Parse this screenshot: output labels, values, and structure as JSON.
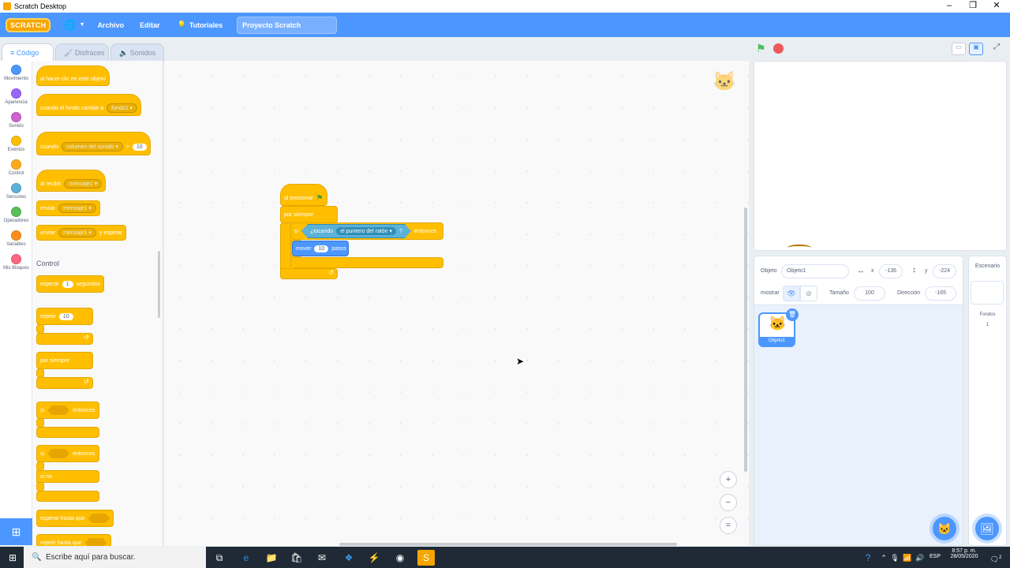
{
  "window": {
    "title": "Scratch Desktop"
  },
  "menu": {
    "logo": "SCRATCH",
    "archivo": "Archivo",
    "editar": "Editar",
    "tutoriales": "Tutoriales",
    "project_name": "Proyecto Scratch"
  },
  "tabs": {
    "code": "Código",
    "costumes": "Disfraces",
    "sounds": "Sonidos"
  },
  "categories": [
    {
      "label": "Movimiento",
      "color": "#4c97ff"
    },
    {
      "label": "Apariencia",
      "color": "#9966ff"
    },
    {
      "label": "Sonido",
      "color": "#cf63cf"
    },
    {
      "label": "Eventos",
      "color": "#ffbf00"
    },
    {
      "label": "Control",
      "color": "#ffab19"
    },
    {
      "label": "Sensores",
      "color": "#5cb1d6"
    },
    {
      "label": "Operadores",
      "color": "#59c059"
    },
    {
      "label": "Variables",
      "color": "#ff8c1a"
    },
    {
      "label": "Mis Bloques",
      "color": "#ff6680"
    }
  ],
  "palette": {
    "ev_click": "al hacer clic en este objeto",
    "ev_backdrop": "cuando el fondo cambie a",
    "ev_backdrop_val": "fondo1",
    "ev_when": "cuando",
    "ev_when_dd": "volumen del sonido",
    "ev_gt": ">",
    "ev_when_val": "10",
    "ev_receive": "al recibir",
    "ev_msg": "mensaje1",
    "ev_send": "enviar",
    "ev_send_msg": "mensaje1",
    "ev_send_wait": "enviar",
    "ev_send_wait_msg": "mensaje1",
    "ev_send_wait_tail": "y esperar",
    "control_heading": "Control",
    "c_wait": "esperar",
    "c_wait_val": "1",
    "c_wait_tail": "segundos",
    "c_repeat": "repetir",
    "c_repeat_val": "10",
    "c_forever": "por siempre",
    "c_if": "si",
    "c_if_tail": "entonces",
    "c_ifelse": "si",
    "c_ifelse_tail": "entonces",
    "c_else": "si no",
    "c_waituntil": "esperar hasta que",
    "c_repeatuntil": "repetir hasta que"
  },
  "script": {
    "hat": "al presionar",
    "forever": "por siempre",
    "if": "si",
    "touching": "¿tocando",
    "touching_dd": "el puntero del ratón",
    "question": "?",
    "then": "entonces",
    "move": "mover",
    "move_val": "10",
    "steps": "pasos"
  },
  "sprite_info": {
    "label_object": "Objeto",
    "object_name": "Objeto1",
    "label_x": "x",
    "x": "-136",
    "label_y": "y",
    "y": "-224",
    "label_show": "mostrar",
    "label_size": "Tamaño",
    "size": "100",
    "label_direction": "Dirección",
    "direction": "-165"
  },
  "sprite_card": {
    "name": "Objeto1"
  },
  "stage_pane": {
    "title": "Escenario",
    "backdrops_label": "Fondos",
    "backdrops_count": "1"
  },
  "taskbar": {
    "search_placeholder": "Escribe aquí para buscar.",
    "lang": "ESP",
    "time": "8:57 p. m.",
    "date": "28/05/2020",
    "notif_count": "2"
  }
}
